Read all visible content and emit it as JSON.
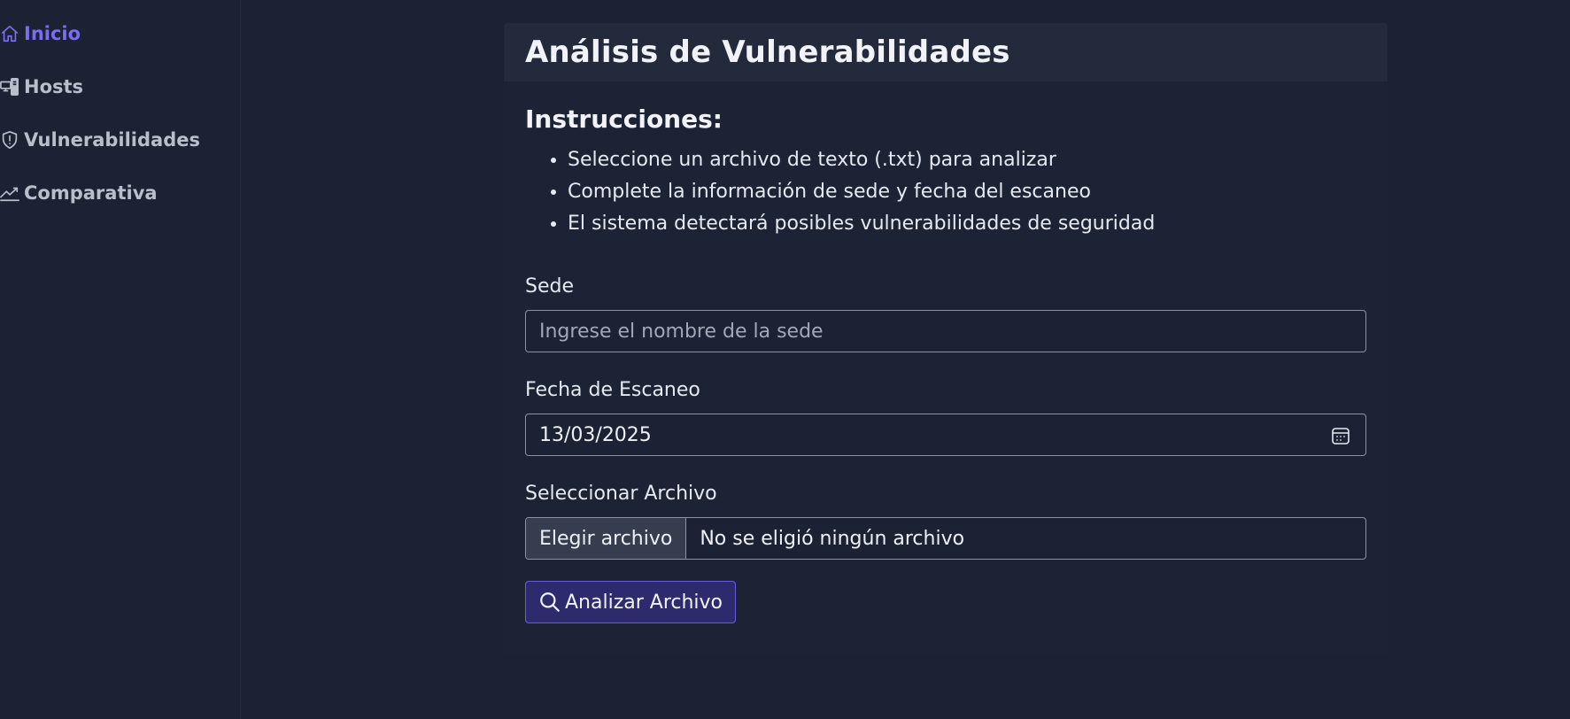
{
  "sidebar": {
    "items": [
      {
        "label": "Inicio",
        "icon": "home-icon",
        "active": true
      },
      {
        "label": "Hosts",
        "icon": "server-icon",
        "active": false
      },
      {
        "label": "Vulnerabilidades",
        "icon": "shield-exclamation-icon",
        "active": false
      },
      {
        "label": "Comparativa",
        "icon": "line-chart-icon",
        "active": false
      }
    ]
  },
  "main": {
    "title": "Análisis de Vulnerabilidades",
    "instructions": {
      "heading": "Instrucciones:",
      "items": [
        "Seleccione un archivo de texto (.txt) para analizar",
        "Complete la información de sede y fecha del escaneo",
        "El sistema detectará posibles vulnerabilidades de seguridad"
      ]
    },
    "form": {
      "sede": {
        "label": "Sede",
        "value": "",
        "placeholder": "Ingrese el nombre de la sede"
      },
      "fecha": {
        "label": "Fecha de Escaneo",
        "value": "13/03/2025",
        "icon": "calendar-icon"
      },
      "archivo": {
        "label": "Seleccionar Archivo",
        "button_label": "Elegir archivo",
        "status": "No se eligió ningún archivo"
      },
      "submit": {
        "label": "Analizar Archivo",
        "icon": "search-icon"
      }
    }
  },
  "colors": {
    "background": "#1b2233",
    "card_header": "#222a3b",
    "accent": "#7c6cf0",
    "button_bg": "#2e2a6e",
    "text": "#e6e9f0"
  }
}
